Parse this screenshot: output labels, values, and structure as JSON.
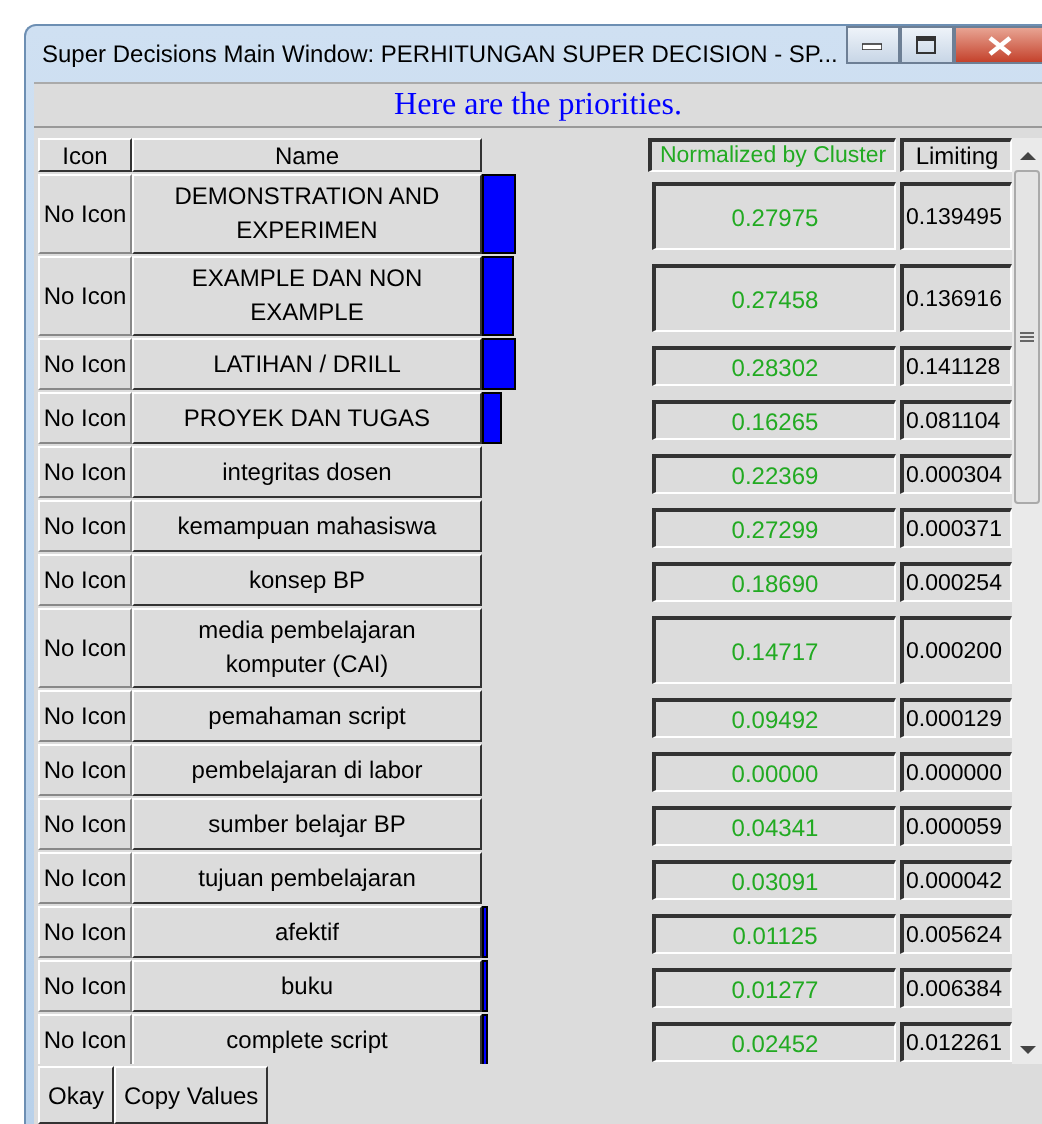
{
  "window": {
    "title": "Super Decisions Main Window: PERHITUNGAN SUPER DECISION - SP..."
  },
  "heading": "Here are the priorities.",
  "columns": {
    "icon": "Icon",
    "name": "Name",
    "normalized": "Normalized by Cluster",
    "limiting": "Limiting"
  },
  "rows": [
    {
      "icon": "No Icon",
      "name": "DEMONSTRATION AND EXPERIMEN",
      "normalized": "0.27975",
      "limiting": "0.139495"
    },
    {
      "icon": "No Icon",
      "name": "EXAMPLE DAN NON EXAMPLE",
      "normalized": "0.27458",
      "limiting": "0.136916"
    },
    {
      "icon": "No Icon",
      "name": "LATIHAN / DRILL",
      "normalized": "0.28302",
      "limiting": "0.141128"
    },
    {
      "icon": "No Icon",
      "name": "PROYEK DAN TUGAS",
      "normalized": "0.16265",
      "limiting": "0.081104"
    },
    {
      "icon": "No Icon",
      "name": "integritas dosen",
      "normalized": "0.22369",
      "limiting": "0.000304"
    },
    {
      "icon": "No Icon",
      "name": "kemampuan mahasiswa",
      "normalized": "0.27299",
      "limiting": "0.000371"
    },
    {
      "icon": "No Icon",
      "name": "konsep BP",
      "normalized": "0.18690",
      "limiting": "0.000254"
    },
    {
      "icon": "No Icon",
      "name": "media pembelajaran komputer (CAI)",
      "normalized": "0.14717",
      "limiting": "0.000200"
    },
    {
      "icon": "No Icon",
      "name": "pemahaman script",
      "normalized": "0.09492",
      "limiting": "0.000129"
    },
    {
      "icon": "No Icon",
      "name": "pembelajaran di labor",
      "normalized": "0.00000",
      "limiting": "0.000000"
    },
    {
      "icon": "No Icon",
      "name": "sumber belajar BP",
      "normalized": "0.04341",
      "limiting": "0.000059"
    },
    {
      "icon": "No Icon",
      "name": "tujuan pembelajaran",
      "normalized": "0.03091",
      "limiting": "0.000042"
    },
    {
      "icon": "No Icon",
      "name": "afektif",
      "normalized": "0.01125",
      "limiting": "0.005624"
    },
    {
      "icon": "No Icon",
      "name": "buku",
      "normalized": "0.01277",
      "limiting": "0.006384"
    },
    {
      "icon": "No Icon",
      "name": "complete script",
      "normalized": "0.02452",
      "limiting": "0.012261"
    }
  ],
  "buttons": [
    "Okay",
    "Copy Values"
  ]
}
